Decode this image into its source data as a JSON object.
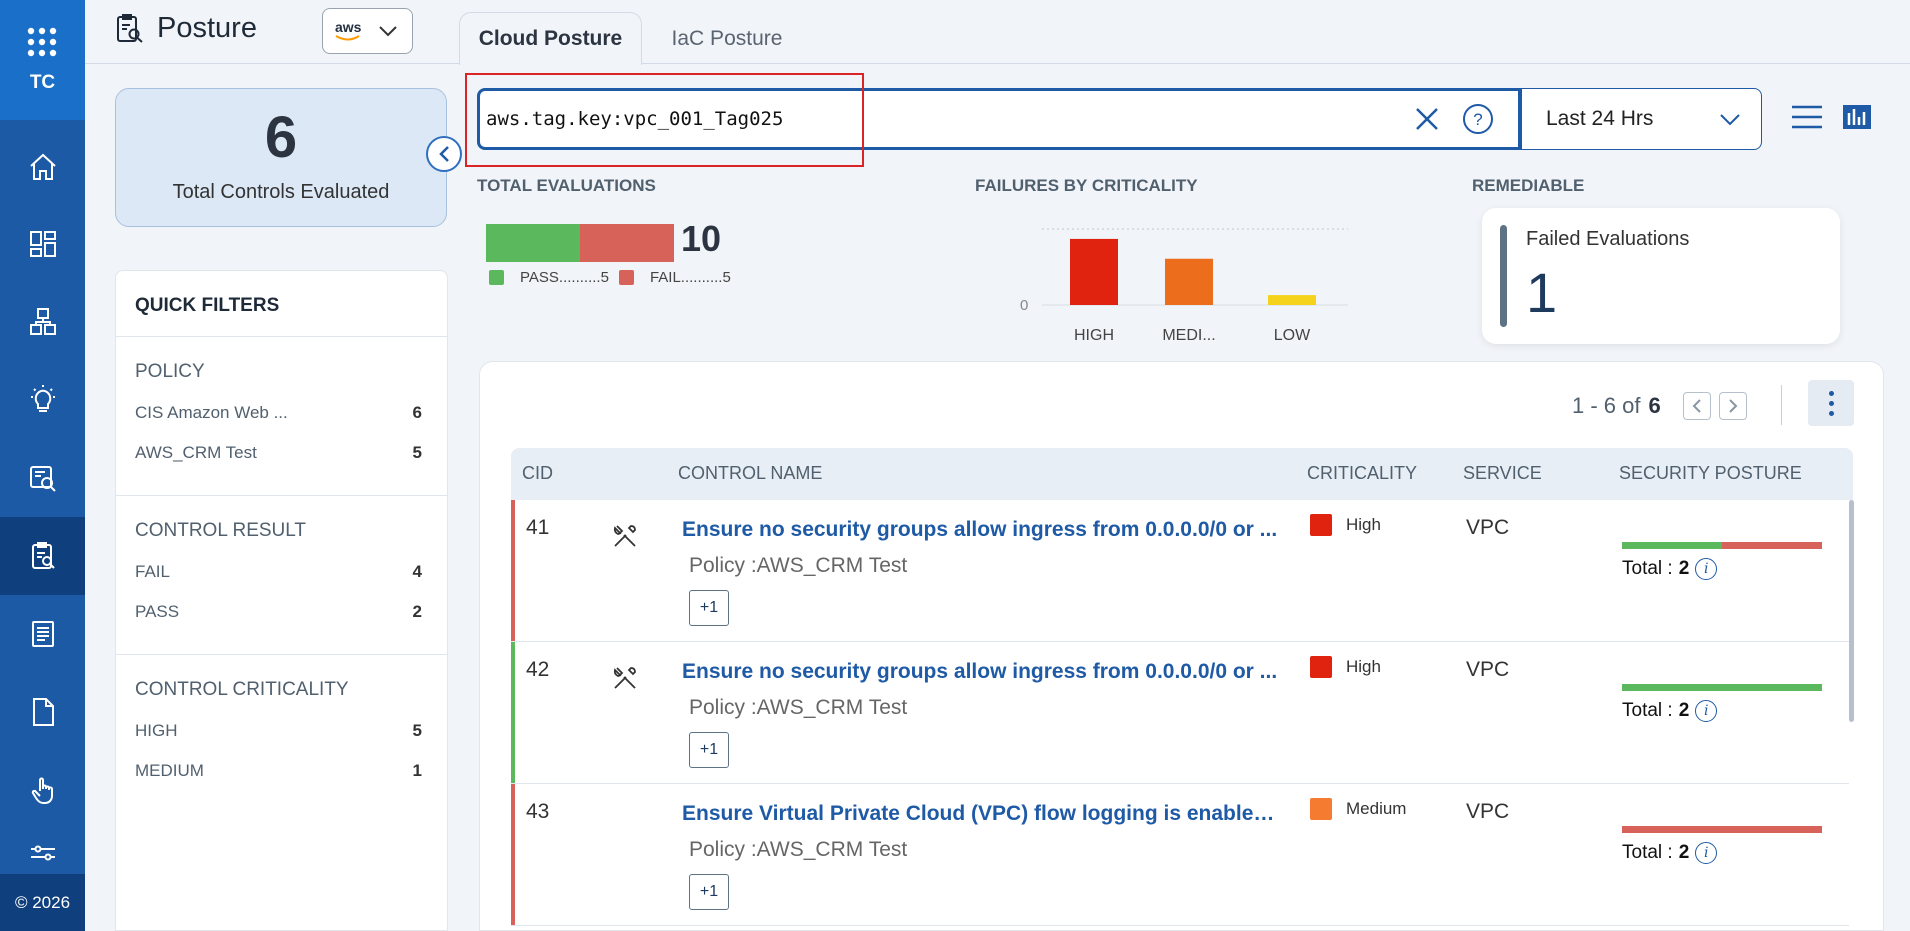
{
  "app": {
    "brand": "TC",
    "footer": "© 2026"
  },
  "header": {
    "title": "Posture",
    "provider": "aws"
  },
  "tabs": [
    {
      "label": "Cloud Posture",
      "active": true
    },
    {
      "label": "IaC Posture",
      "active": false
    }
  ],
  "summary": {
    "total_controls": "6",
    "total_controls_label": "Total Controls Evaluated"
  },
  "search": {
    "query": "aws.tag.key:vpc_001_Tag025",
    "time_range": "Last 24 Hrs"
  },
  "quick_filters": {
    "title": "QUICK FILTERS",
    "sections": [
      {
        "title": "POLICY",
        "items": [
          {
            "label": "CIS Amazon Web ...",
            "count": "6"
          },
          {
            "label": "AWS_CRM Test",
            "count": "5"
          }
        ]
      },
      {
        "title": "CONTROL RESULT",
        "items": [
          {
            "label": "FAIL",
            "count": "4"
          },
          {
            "label": "PASS",
            "count": "2"
          }
        ]
      },
      {
        "title": "CONTROL CRITICALITY",
        "items": [
          {
            "label": "HIGH",
            "count": "5"
          },
          {
            "label": "MEDIUM",
            "count": "1"
          }
        ]
      }
    ]
  },
  "evaluations": {
    "label": "TOTAL EVALUATIONS",
    "total": "10",
    "pass_legend": "PASS..........5",
    "fail_legend": "FAIL..........5",
    "pass_color": "#5cb85c",
    "fail_color": "#d6625a"
  },
  "failures": {
    "label": "FAILURES BY CRITICALITY",
    "y_tick": "0"
  },
  "chart_data": {
    "type": "bar",
    "categories": [
      "HIGH",
      "MEDI...",
      "LOW"
    ],
    "values": [
      4,
      2.8,
      0.6
    ],
    "colors": [
      "#e0230f",
      "#ec6d1c",
      "#f5d31c"
    ],
    "yticks": [
      "0"
    ]
  },
  "remediable": {
    "label": "REMEDIABLE",
    "card_label": "Failed Evaluations",
    "value": "1"
  },
  "pagination": {
    "range": "1 - 6 of",
    "total": "6"
  },
  "table": {
    "columns": [
      "CID",
      "CONTROL NAME",
      "CRITICALITY",
      "SERVICE",
      "SECURITY POSTURE"
    ],
    "rows": [
      {
        "cid": "41",
        "name": "Ensure no security groups allow ingress from 0.0.0.0/0 or ...",
        "policy": "Policy :AWS_CRM Test",
        "more": "+1",
        "criticality": "High",
        "crit_color": "#e0230f",
        "service": "VPC",
        "total_label": "Total :",
        "total_value": "2",
        "edge_color": "#d6625a",
        "pass_fraction": 0.5
      },
      {
        "cid": "42",
        "name": "Ensure no security groups allow ingress from 0.0.0.0/0 or ...",
        "policy": "Policy :AWS_CRM Test",
        "more": "+1",
        "criticality": "High",
        "crit_color": "#e0230f",
        "service": "VPC",
        "total_label": "Total :",
        "total_value": "2",
        "edge_color": "#5cb85c",
        "pass_fraction": 1.0
      },
      {
        "cid": "43",
        "name": "Ensure Virtual Private Cloud (VPC) flow logging is enabled...",
        "policy": "Policy :AWS_CRM Test",
        "more": "+1",
        "criticality": "Medium",
        "crit_color": "#f47b30",
        "service": "VPC",
        "total_label": "Total :",
        "total_value": "2",
        "edge_color": "#d6625a",
        "pass_fraction": 0.0
      }
    ]
  }
}
